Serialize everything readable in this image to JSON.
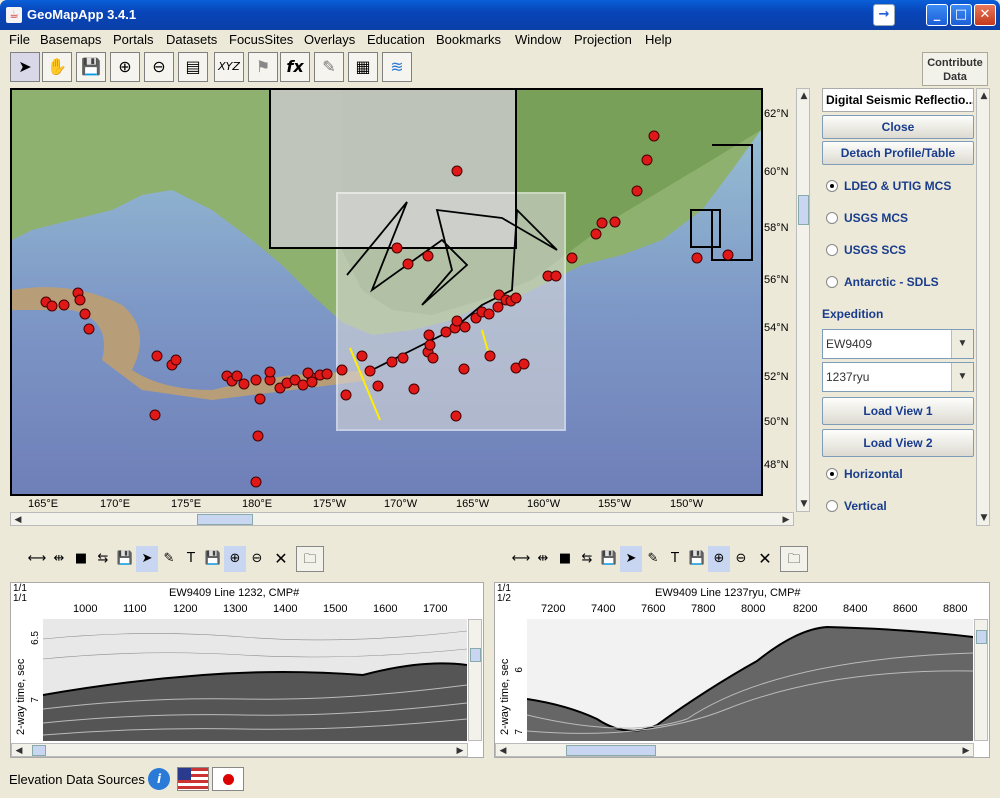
{
  "window": {
    "title": "GeoMapApp 3.4.1"
  },
  "menu": [
    "File",
    "Basemaps",
    "Portals",
    "Datasets",
    "FocusSites",
    "Overlays",
    "Education",
    "Bookmarks",
    "Window",
    "Projection",
    "Help"
  ],
  "toolbar": {
    "tools": [
      "select-arrow-icon",
      "pan-hand-icon",
      "save-disk-icon",
      "zoom-in-icon",
      "zoom-out-icon",
      "profile-chart-icon",
      "xyz-icon",
      "flag-icon",
      "fx-icon",
      "digitize-icon",
      "grid-icon",
      "layers-icon"
    ],
    "contribute_label_1": "Contribute",
    "contribute_label_2": "Data"
  },
  "map": {
    "lat_labels": [
      "62°N",
      "60°N",
      "58°N",
      "56°N",
      "54°N",
      "52°N",
      "50°N",
      "48°N"
    ],
    "lon_labels": [
      "165°E",
      "170°E",
      "175°E",
      "180°E",
      "175°W",
      "170°W",
      "165°W",
      "160°W",
      "155°W",
      "150°W"
    ]
  },
  "sidebar": {
    "title": "Digital Seismic Reflectio...",
    "close_label": "Close",
    "detach_label": "Detach Profile/Table",
    "radios": [
      "LDEO & UTIG MCS",
      "USGS MCS",
      "USGS SCS",
      "Antarctic - SDLS"
    ],
    "expedition_label": "Expedition",
    "expedition_value": "EW9409",
    "line_value": "1237ryu",
    "load1": "Load View 1",
    "load2": "Load View 2",
    "orient": [
      "Horizontal",
      "Vertical"
    ]
  },
  "profile1": {
    "title": "EW9409 Line 1232, CMP#",
    "scale_a": "1/1",
    "scale_b": "1/1",
    "xticks": [
      "1000",
      "1100",
      "1200",
      "1300",
      "1400",
      "1500",
      "1600",
      "1700"
    ],
    "yticks": [
      "6.5",
      "7"
    ],
    "ylabel": "2-way time, sec"
  },
  "profile2": {
    "title": "EW9409 Line 1237ryu, CMP#",
    "scale_a": "1/1",
    "scale_b": "1/2",
    "xticks": [
      "7200",
      "7400",
      "7600",
      "7800",
      "8000",
      "8200",
      "8400",
      "8600",
      "8800"
    ],
    "yticks": [
      "6",
      "7"
    ],
    "ylabel": "2-way time, sec"
  },
  "footer": {
    "label": "Elevation Data Sources"
  },
  "colors": {
    "titlebar": "#0a4fc8",
    "marker": "#e01818",
    "button_text": "#1a3c8c"
  }
}
